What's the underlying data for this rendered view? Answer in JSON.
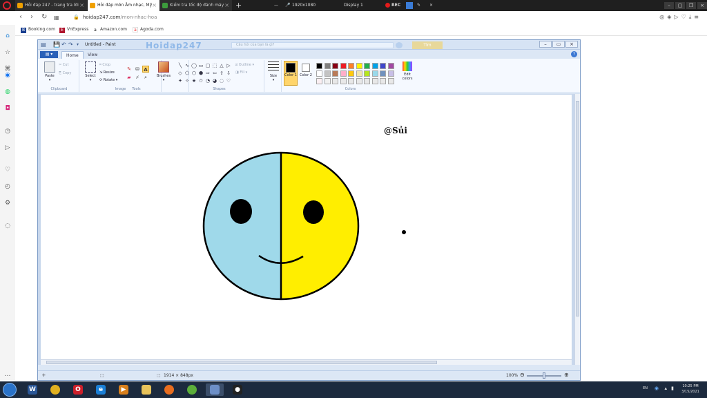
{
  "browser": {
    "tabs": [
      {
        "title": "Hỏi đáp 247 - trang tra lời",
        "color": "#f0a000",
        "active": false
      },
      {
        "title": "Hỏi đáp môn Âm nhạc, Mỹ",
        "color": "#f0a000",
        "active": true
      },
      {
        "title": "Kiểm tra tốc độ đánh máy",
        "color": "#3c9c3c",
        "active": false
      }
    ],
    "new_tab": "+",
    "recorder": {
      "resolution": "1920x1080",
      "display": "Display 1",
      "rec": "REC"
    },
    "url_host": "hoidap247.com",
    "url_path": "/mon-nhac-hoa",
    "bookmarks": [
      {
        "label": "Booking.com",
        "icon_letter": "B",
        "color": "#1a3f8f"
      },
      {
        "label": "VnExpress",
        "icon_letter": "E",
        "color": "#b0152d"
      },
      {
        "label": "Amazon.com",
        "icon_letter": "a",
        "color": "#111111"
      },
      {
        "label": "Agoda.com",
        "icon_letter": "a",
        "color": "#ffffff"
      }
    ]
  },
  "paint": {
    "title": "Untitled - Paint",
    "overlay_brand": "Hoidap247",
    "overlay_search": "Câu hỏi của bạn là gì?",
    "overlay_button": "Tìm",
    "file_button": "",
    "tabs": [
      "Home",
      "View"
    ],
    "ribbon": {
      "clipboard": {
        "label": "Clipboard",
        "paste": "Paste",
        "cut": "Cut",
        "copy": "Copy"
      },
      "image": {
        "label": "Image",
        "select": "Select",
        "crop": "Crop",
        "resize": "Resize",
        "rotate": "Rotate"
      },
      "tools": {
        "label": "Tools",
        "brushes": "Brushes"
      },
      "shapes": {
        "label": "Shapes",
        "outline": "Outline",
        "fill": "Fill"
      },
      "size": "Size",
      "colors": {
        "label": "Colors",
        "color1": "Color 1",
        "color2": "Color 2",
        "edit": "Edit colors"
      }
    },
    "canvas": {
      "watermark": "@Sủi",
      "face": {
        "left_color": "#9fd9ea",
        "right_color": "#ffee00",
        "outline": "#000000"
      }
    },
    "status": {
      "size": "1914 × 848px",
      "zoom": "100%"
    }
  },
  "palette": [
    "#000000",
    "#7f7f7f",
    "#880015",
    "#ed1c24",
    "#ff7f27",
    "#fff200",
    "#22b14c",
    "#00a2e8",
    "#3f48cc",
    "#a349a4",
    "#ffffff",
    "#c3c3c3",
    "#b97a57",
    "#ffaec9",
    "#ffc90e",
    "#efe4b0",
    "#b5e61d",
    "#99d9ea",
    "#7092be",
    "#c8bfe7",
    "#fbeff2",
    "#f0f0f0",
    "#e8e8e8",
    "#e8e8e8",
    "#e8e8e8",
    "#e8e8e8",
    "#e8e8e8",
    "#e8e8e8",
    "#e8e8e8",
    "#e8e8e8"
  ],
  "taskbar": {
    "apps": [
      {
        "name": "word",
        "letter": "W",
        "color": "#2b5797"
      },
      {
        "name": "chrome",
        "letter": "",
        "color": "#e0b020"
      },
      {
        "name": "opera",
        "letter": "O",
        "color": "#cc1f2a"
      },
      {
        "name": "ie",
        "letter": "e",
        "color": "#1b7fd6"
      },
      {
        "name": "media",
        "letter": "▶",
        "color": "#d87f1c"
      },
      {
        "name": "explorer",
        "letter": "",
        "color": "#e8c25a"
      },
      {
        "name": "firefox",
        "letter": "",
        "color": "#e86d1f"
      },
      {
        "name": "app-green",
        "letter": "",
        "color": "#5cae3a"
      },
      {
        "name": "paint",
        "letter": "",
        "color": "#6d8fc7"
      },
      {
        "name": "recorder",
        "letter": "●",
        "color": "#222222"
      }
    ],
    "clock_time": "10:25 PM",
    "clock_date": "3/15/2021",
    "lang": "EN"
  }
}
